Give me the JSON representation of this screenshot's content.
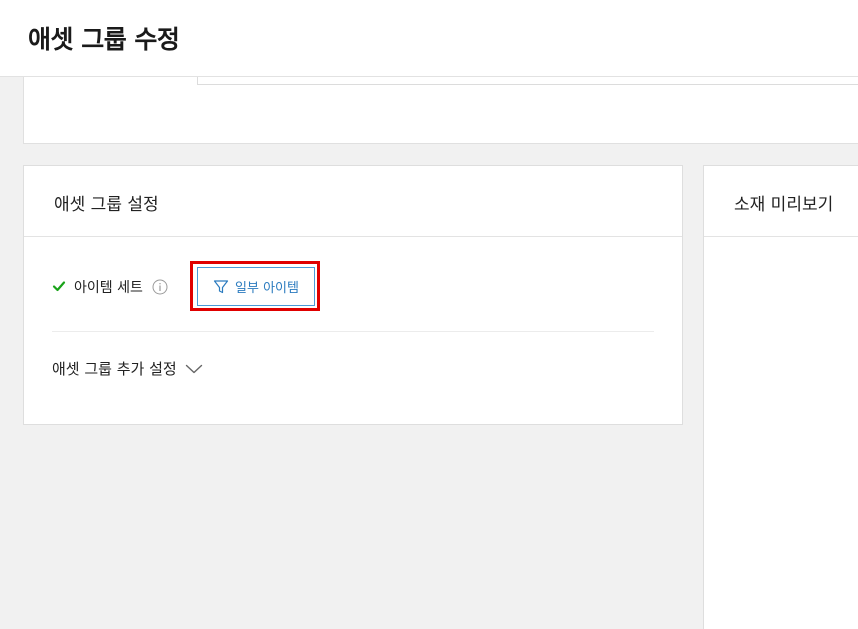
{
  "header": {
    "title": "애셋 그룹 수정"
  },
  "settings": {
    "title": "애셋 그룹 설정",
    "item_set_label": "아이템 세트",
    "filter_button_label": "일부 아이템",
    "advanced_label": "애셋 그룹 추가 설정"
  },
  "preview": {
    "title": "소재 미리보기"
  },
  "icons": {
    "check": "check-icon",
    "info": "info-icon",
    "filter": "filter-icon",
    "chevron": "chevron-down-icon"
  },
  "colors": {
    "accent": "#2b7bbf",
    "check": "#1aa31a",
    "highlight": "#e00000"
  }
}
